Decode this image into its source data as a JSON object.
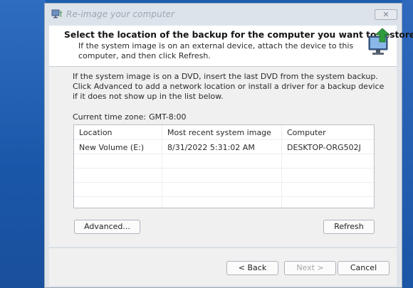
{
  "window": {
    "title": "Re-image your computer",
    "close_glyph": "✕"
  },
  "header": {
    "title": "Select the location of the backup for the computer you want to restore",
    "subtitle": "If the system image is on an external device, attach the device to this computer, and then click Refresh."
  },
  "body": {
    "description": "If the system image is on a DVD, insert the last DVD from the system backup. Click Advanced to add a network location or install a driver for a backup device if it does not show up in the list below.",
    "timezone_label": "Current time zone:",
    "timezone_value": "GMT-8:00"
  },
  "table": {
    "columns": [
      "Location",
      "Most recent system image",
      "Computer"
    ],
    "rows": [
      [
        "New Volume (E:)",
        "8/31/2022 5:31:02 AM",
        "DESKTOP-ORG502J"
      ]
    ]
  },
  "buttons": {
    "advanced": "Advanced...",
    "refresh": "Refresh",
    "back": "< Back",
    "next": "Next >",
    "cancel": "Cancel"
  },
  "icons": {
    "app": "backup-monitor-icon",
    "header": "monitor-restore-icon"
  }
}
